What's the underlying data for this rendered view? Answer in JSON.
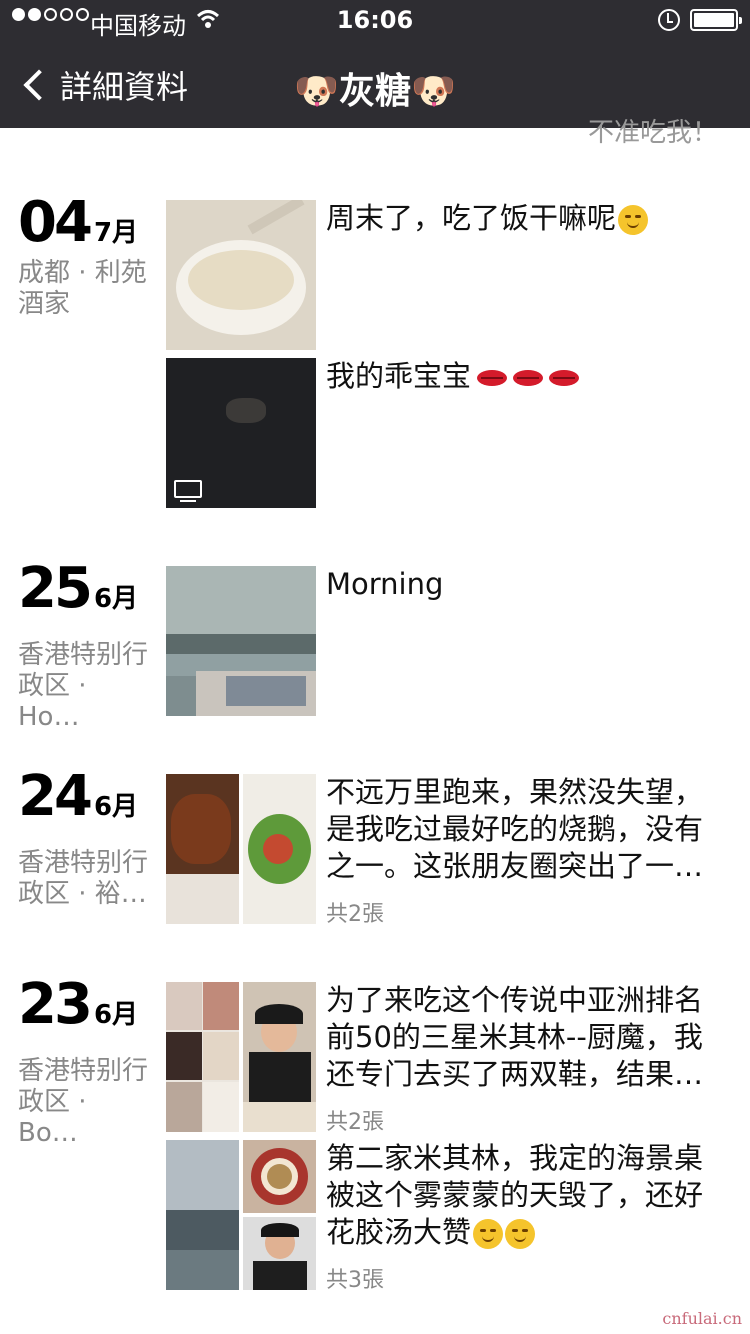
{
  "status_bar": {
    "carrier": "中国移动",
    "time": "16:06"
  },
  "nav": {
    "back_label": "詳細資料",
    "title": "🐶灰糖🐶"
  },
  "signature": "不准吃我！",
  "posts": [
    {
      "day": "04",
      "month": "7月",
      "location": "成都 · 利苑酒家",
      "entries": [
        {
          "text": "周末了，吃了饭干嘛呢",
          "photo_desc": "soup-bowl",
          "has_emoji": "dizzy-face-emoji"
        },
        {
          "text": "我的乖宝宝",
          "photo_desc": "dog-video",
          "video": true,
          "emoji": [
            "lips",
            "lips",
            "lips"
          ]
        }
      ]
    },
    {
      "day": "25",
      "month": "6月",
      "location": "香港特别行政区 · Ho…",
      "entries": [
        {
          "text": "Morning",
          "photo_desc": "harbour-view"
        }
      ]
    },
    {
      "day": "24",
      "month": "6月",
      "location": "香港特别行政区 · 裕…",
      "entries": [
        {
          "text": "不远万里跑来，果然没失望，是我吃过最好吃的烧鹅，没有之一。这张朋友圈突出了一…",
          "count": "共2張"
        }
      ]
    },
    {
      "day": "23",
      "month": "6月",
      "location": "香港特别行政区 · Bo…",
      "entries": [
        {
          "text": "为了来吃这个传说中亚洲排名前50的三星米其林--厨魔，我还专门去买了两双鞋，结果…",
          "count": "共2張"
        },
        {
          "text": "第二家米其林，我定的海景桌被这个雾蒙蒙的天毁了，还好花胶汤大赞",
          "count": "共3張"
        }
      ]
    }
  ],
  "watermark": "cnfulai.cn"
}
